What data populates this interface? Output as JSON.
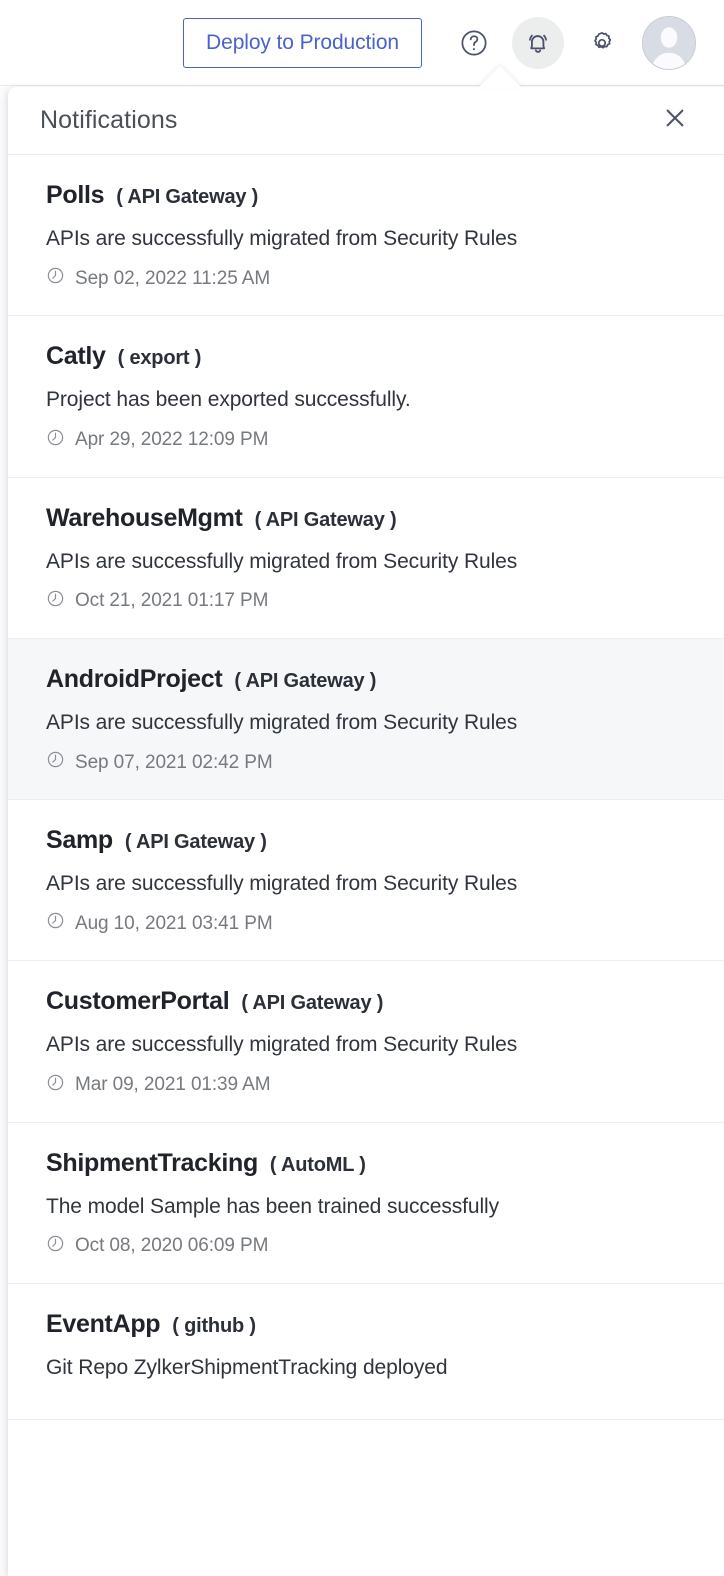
{
  "topbar": {
    "deploy_button_label": "Deploy to Production",
    "help_icon": "help-circle-icon",
    "bell_icon": "bell-icon",
    "settings_icon": "gear-icon",
    "avatar_icon": "user-avatar-icon",
    "accent_color": "#4a63c8"
  },
  "panel": {
    "title": "Notifications",
    "close_icon": "close-icon",
    "clock_icon": "clock-icon",
    "notifications": [
      {
        "project": "Polls",
        "module": "( API Gateway )",
        "message": "APIs are successfully migrated from Security Rules",
        "time": "Sep 02, 2022 11:25 AM",
        "highlighted": false
      },
      {
        "project": "Catly",
        "module": "( export )",
        "message": "Project has been exported successfully.",
        "time": "Apr 29, 2022 12:09 PM",
        "highlighted": false
      },
      {
        "project": "WarehouseMgmt",
        "module": "( API Gateway )",
        "message": "APIs are successfully migrated from Security Rules",
        "time": "Oct 21, 2021 01:17 PM",
        "highlighted": false
      },
      {
        "project": "AndroidProject",
        "module": "( API Gateway )",
        "message": "APIs are successfully migrated from Security Rules",
        "time": "Sep 07, 2021 02:42 PM",
        "highlighted": true
      },
      {
        "project": "Samp",
        "module": "( API Gateway )",
        "message": "APIs are successfully migrated from Security Rules",
        "time": "Aug 10, 2021 03:41 PM",
        "highlighted": false
      },
      {
        "project": "CustomerPortal",
        "module": "( API Gateway )",
        "message": "APIs are successfully migrated from Security Rules",
        "time": "Mar 09, 2021 01:39 AM",
        "highlighted": false
      },
      {
        "project": "ShipmentTracking",
        "module": "( AutoML )",
        "message": "The model Sample has been trained successfully",
        "time": "Oct 08, 2020 06:09 PM",
        "highlighted": false
      },
      {
        "project": "EventApp",
        "module": "( github )",
        "message": "Git Repo ZylkerShipmentTracking deployed",
        "time": "",
        "highlighted": false
      }
    ]
  }
}
